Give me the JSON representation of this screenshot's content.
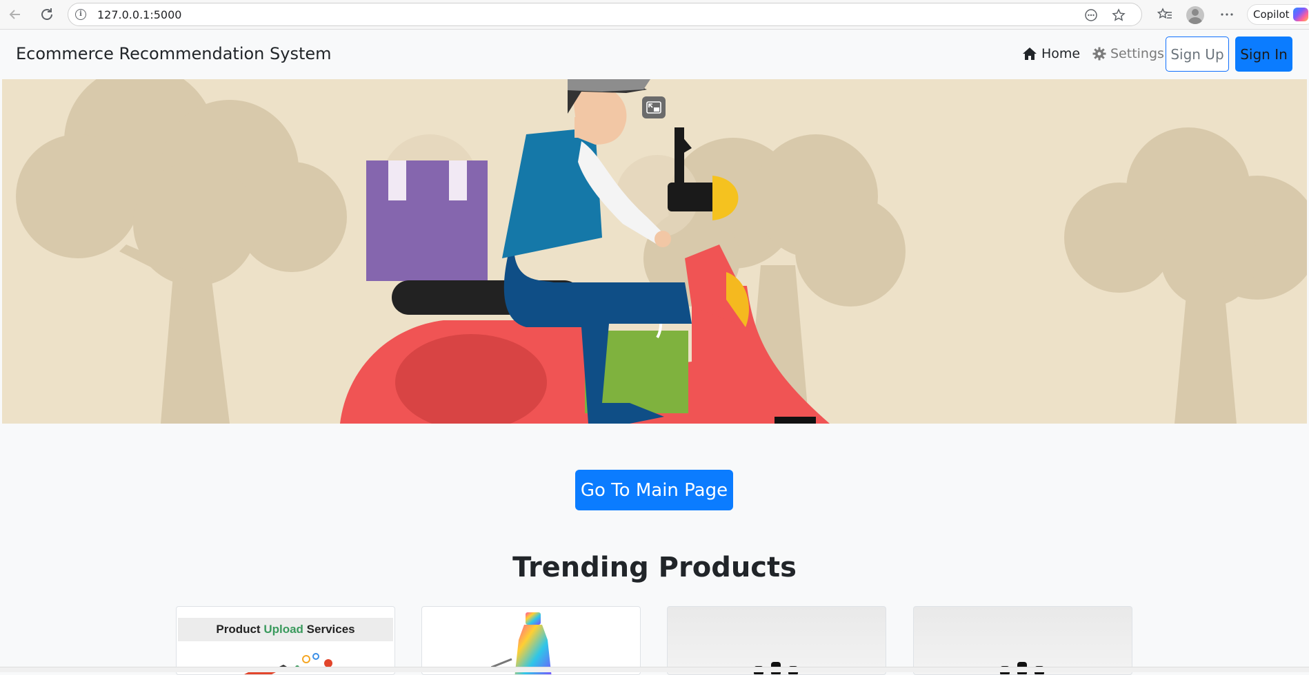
{
  "browser": {
    "url": "127.0.0.1:5000",
    "copilot_label": "Copilot"
  },
  "navbar": {
    "brand": "Ecommerce Recommendation System",
    "home": "Home",
    "settings": "Settings",
    "signup": "Sign Up",
    "signin": "Sign In"
  },
  "main": {
    "cta": "Go To Main Page",
    "section_title": "Trending Products"
  },
  "products": [
    {
      "banner_prefix": "Product ",
      "banner_highlight": "Upload",
      "banner_suffix": " Services"
    }
  ],
  "colors": {
    "primary": "#0b7cff",
    "hero_bg": "#ede1c8",
    "scooter": "#f05454",
    "box": "#8566ae",
    "bag": "#7fb23e"
  }
}
